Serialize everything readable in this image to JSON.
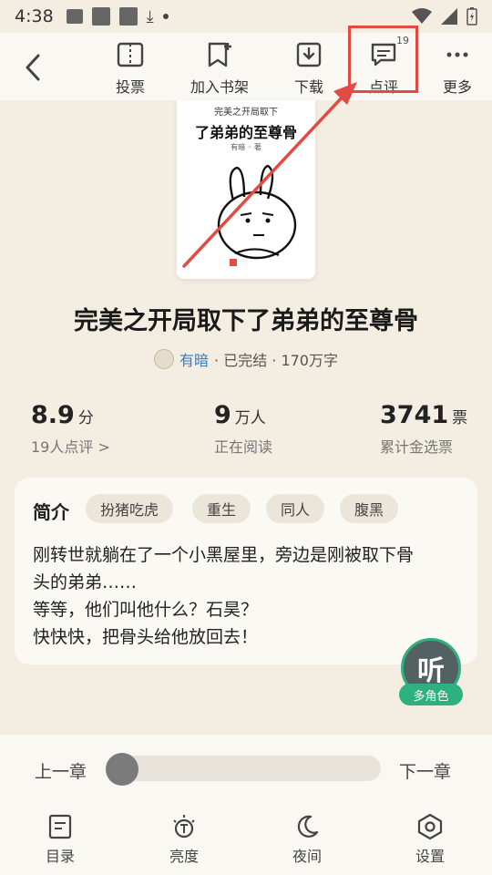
{
  "status_bar": {
    "time": "4:38"
  },
  "toolbar": {
    "vote_label": "投票",
    "bookshelf_label": "加入书架",
    "download_label": "下载",
    "comment_label": "点评",
    "comment_count": "19",
    "more_label": "更多"
  },
  "cover": {
    "small_title": "完美之开局取下",
    "title": "了弟弟的至尊骨",
    "author": "有暗 ◦ 著"
  },
  "book": {
    "title": "完美之开局取下了弟弟的至尊骨",
    "author": "有暗",
    "meta": "· 已完结 · 170万字"
  },
  "stats": {
    "score_value": "8.9",
    "score_unit": "分",
    "score_sub": "19人点评 >",
    "readers_value": "9",
    "readers_unit": "万人",
    "readers_sub": "正在阅读",
    "tickets_value": "3741",
    "tickets_unit": "票",
    "tickets_sub": "累计金选票"
  },
  "intro": {
    "heading": "简介",
    "tags": [
      "扮猪吃虎",
      "重生",
      "同人",
      "腹黑"
    ],
    "lines": [
      "刚转世就躺在了一个小黑屋里，旁边是刚被取下骨",
      "头的弟弟……",
      "等等，他们叫他什么？石昊？",
      "快快快，把骨头给他放回去！"
    ]
  },
  "listen": {
    "label": "听",
    "tag": "多角色"
  },
  "chapter_nav": {
    "prev": "上一章",
    "next": "下一章",
    "progress": 0
  },
  "bottom_nav": {
    "toc": "目录",
    "brightness": "亮度",
    "night": "夜间",
    "settings": "设置"
  },
  "colors": {
    "background": "#f3ede2",
    "accent_green": "#2fb07f",
    "highlight_red": "#e24b44",
    "author_blue": "#3a7bbf"
  }
}
